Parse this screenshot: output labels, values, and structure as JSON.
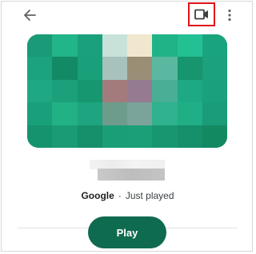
{
  "toolbar": {
    "back_icon": "arrow-left-icon",
    "video_icon": "video-camera-icon",
    "more_icon": "more-vertical-icon",
    "highlight_color": "#e0131a"
  },
  "media": {
    "source": "Google",
    "separator": "·",
    "status": "Just played",
    "accent_color": "#0f6b4f"
  },
  "actions": {
    "play_label": "Play"
  }
}
